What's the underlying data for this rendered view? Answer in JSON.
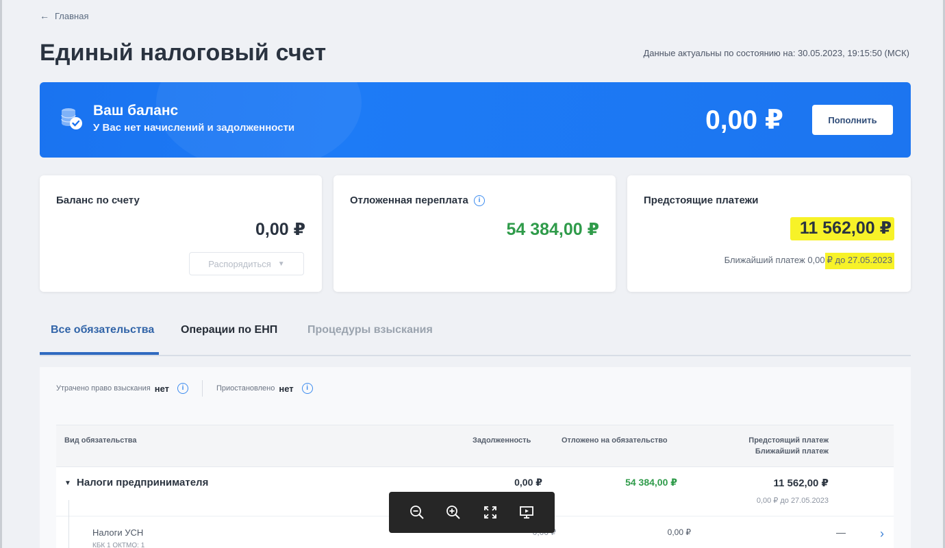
{
  "nav": {
    "back_label": "Главная"
  },
  "header": {
    "title": "Единый налоговый счет",
    "actual_text": "Данные актуальны по состоянию на: 30.05.2023, 19:15:50 (МСК)"
  },
  "banner": {
    "title": "Ваш баланс",
    "subtitle": "У Вас нет начислений и задолженности",
    "amount": "0,00 ₽",
    "topup_label": "Пополнить",
    "color": "#1a73f0"
  },
  "cards": {
    "account_balance": {
      "title": "Баланс по счету",
      "amount": "0,00 ₽",
      "action_label": "Распорядиться"
    },
    "deferred_overpayment": {
      "title": "Отложенная переплата",
      "amount": "54 384,00 ₽",
      "amount_color": "#2f9b4a"
    },
    "upcoming_payments": {
      "title": "Предстоящие платежи",
      "amount": "11 562,00 ₽",
      "next_payment_prefix": "Ближайший платеж 0,00",
      "next_payment_highlight": "₽ до 27.05.2023",
      "highlight_color": "#f7f228"
    }
  },
  "tabs": [
    {
      "label": "Все обязательства",
      "active": true
    },
    {
      "label": "Операции по ЕНП",
      "active": false
    },
    {
      "label": "Процедуры взыскания",
      "active": false
    }
  ],
  "filters": {
    "lost_right_label": "Утрачено право взыскания",
    "lost_right_value": "нет",
    "suspended_label": "Приостановлено",
    "suspended_value": "нет"
  },
  "table": {
    "headers": {
      "type": "Вид обязательства",
      "debt": "Задолженность",
      "deferred": "Отложено на обязательство",
      "upcoming": "Предстоящий платеж",
      "nearest": "Ближайший платеж"
    },
    "rows": [
      {
        "name": "Налоги предпринимателя",
        "debt": "0,00 ₽",
        "deferred": "54 384,00 ₽",
        "upcoming": "11 562,00 ₽",
        "nearest": "0,00 ₽ до 27.05.2023"
      },
      {
        "name": "Налоги УСН",
        "code": "КБК 1 ОКТМО: 1",
        "debt": "0,00 ₽",
        "deferred": "0,00 ₽",
        "upcoming": "—"
      }
    ]
  },
  "viewer_toolbar": {
    "icons": [
      "zoom-out-icon",
      "zoom-in-icon",
      "fullscreen-icon",
      "slideshow-icon"
    ]
  }
}
